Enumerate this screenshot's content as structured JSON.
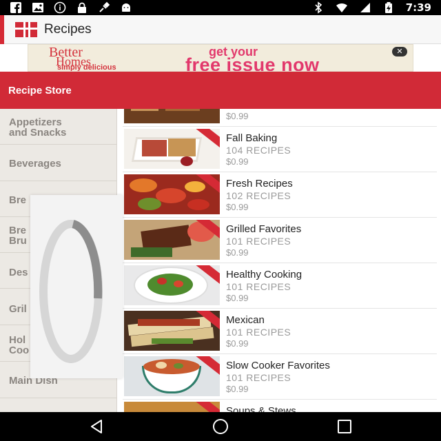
{
  "status_bar": {
    "time": "7:39",
    "icons": [
      "facebook-icon",
      "picture-icon",
      "info-icon",
      "lock-icon",
      "cable-icon",
      "android-icon",
      "bluetooth-icon",
      "wifi-icon",
      "signal-icon",
      "battery-icon"
    ]
  },
  "app_bar": {
    "title": "Recipes",
    "logo_icon": "recipes-logo-icon"
  },
  "ad": {
    "brand_line1": "Better",
    "brand_line2": "Homes",
    "brand_sub": "simply delicious",
    "cta_line1": "get your",
    "cta_line2": "free issue now",
    "close_label": "✕"
  },
  "store": {
    "title": "Recipe Store"
  },
  "sidebar": {
    "items": [
      {
        "label": "Appetizers\nand Snacks"
      },
      {
        "label": "Beverages"
      },
      {
        "label": "Bre"
      },
      {
        "label": "Bre\nBru"
      },
      {
        "label": "Des"
      },
      {
        "label": "Gril"
      },
      {
        "label": "Hol\nCoo"
      },
      {
        "label": "Main Dish"
      }
    ]
  },
  "recipes": [
    {
      "title": "",
      "count": "",
      "price": "$0.99",
      "image": "bars"
    },
    {
      "title": "Fall Baking",
      "count": "104 RECIPES",
      "price": "$0.99",
      "image": "baking"
    },
    {
      "title": "Fresh Recipes",
      "count": "102 RECIPES",
      "price": "$0.99",
      "image": "fresh"
    },
    {
      "title": "Grilled Favorites",
      "count": "101 RECIPES",
      "price": "$0.99",
      "image": "grilled"
    },
    {
      "title": "Healthy Cooking",
      "count": "101 RECIPES",
      "price": "$0.99",
      "image": "salad"
    },
    {
      "title": "Mexican",
      "count": "101 RECIPES",
      "price": "$0.99",
      "image": "mexican"
    },
    {
      "title": "Slow Cooker Favorites",
      "count": "101 RECIPES",
      "price": "$0.99",
      "image": "slowcooker"
    },
    {
      "title": "Soups & Stews",
      "count": "",
      "price": "",
      "image": "soup"
    }
  ],
  "nav_bar": {
    "buttons": [
      "back-icon",
      "home-icon",
      "recents-icon"
    ]
  },
  "colors": {
    "brand_red": "#d12a37",
    "sidebar_bg": "#ece9e4",
    "text_muted": "#9a9a9a"
  }
}
